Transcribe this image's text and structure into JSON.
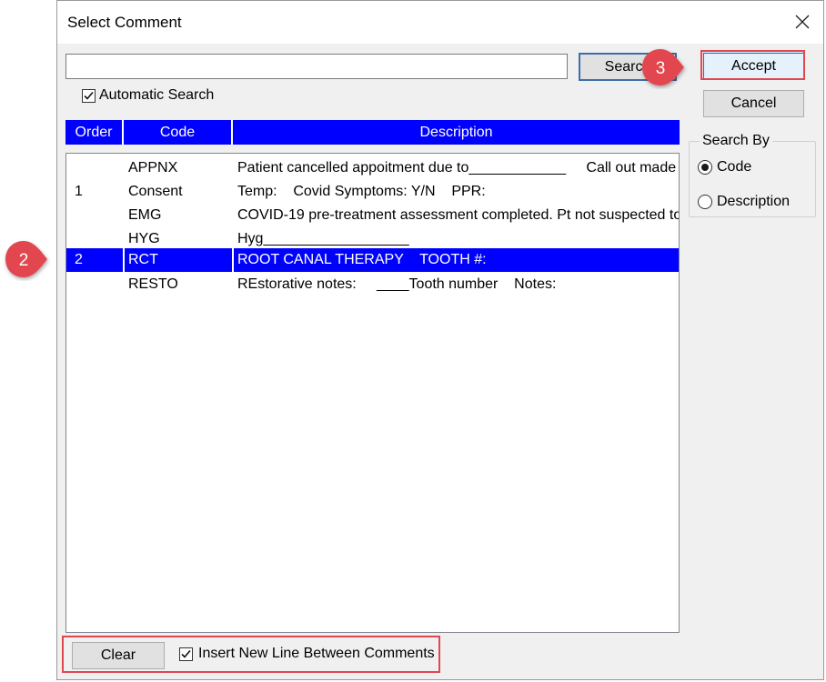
{
  "dialog": {
    "title": "Select Comment",
    "search_value": "",
    "search_button": "Search",
    "accept_button": "Accept",
    "cancel_button": "Cancel",
    "automatic_search_label": "Automatic Search",
    "automatic_search_checked": true,
    "search_by": {
      "label": "Search By",
      "options": [
        "Code",
        "Description"
      ],
      "selected": "Code"
    },
    "columns": [
      "Order",
      "Code",
      "Description"
    ],
    "rows": [
      {
        "order": "",
        "code": "APPNX",
        "description": "Patient cancelled appoitment due to____________     Call out made"
      },
      {
        "order": "1",
        "code": "Consent",
        "description": "Temp:    Covid Symptoms: Y/N    PPR:"
      },
      {
        "order": "",
        "code": "EMG",
        "description": "COVID-19 pre-treatment assessment completed. Pt not suspected to"
      },
      {
        "order": "",
        "code": "HYG",
        "description": "Hyg__________________"
      },
      {
        "order": "2",
        "code": "RCT",
        "description": "ROOT CANAL THERAPY    TOOTH #:"
      },
      {
        "order": "",
        "code": "RESTO",
        "description": "REstorative notes:     ____Tooth number    Notes:"
      }
    ],
    "selected_row_index": 4,
    "clear_button": "Clear",
    "insert_new_line_label": "Insert New Line Between Comments",
    "insert_new_line_checked": true
  },
  "annotations": {
    "step_2": "2",
    "step_3": "3",
    "accent_color": "#e2464f"
  },
  "colors": {
    "header_blue": "#0000ff",
    "selection_blue": "#0000ff"
  }
}
